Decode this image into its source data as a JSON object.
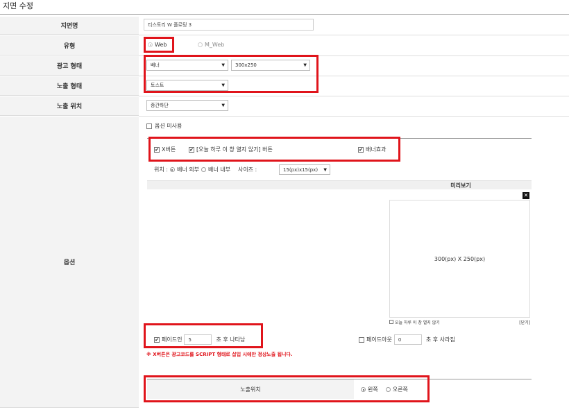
{
  "page": {
    "title": "지면 수정"
  },
  "rows": {
    "name": {
      "label": "지면명",
      "value": "티스토리 W 플로팅 3"
    },
    "type": {
      "label": "유형",
      "options": [
        "Web",
        "M_Web"
      ]
    },
    "ad_format": {
      "label": "광고 형태",
      "format_value": "배너",
      "size_value": "300x250"
    },
    "display_format": {
      "label": "노출 형태",
      "value": "토스트"
    },
    "display_position": {
      "label": "노출 위치",
      "value": "중간하단"
    },
    "options": {
      "label": "옵션"
    }
  },
  "options": {
    "unused_label": "옵션 미사용",
    "x_button_label": "X버튼",
    "no_show_today_label": "[오늘 하루 이 창 열지 않기] 버튼",
    "banner_effect_label": "배너효과",
    "position_label": "위치 :",
    "pos_outside_label": "배너 외부",
    "pos_inside_label": "배너 내부",
    "size_label": "사이즈 :",
    "size_value": "15(px)x15(px)",
    "preview_title": "미리보기",
    "preview_text": "300(px) X 250(px)",
    "preview_footer_left": "오늘 하루 이 창 열지 않기",
    "preview_footer_right": "[닫기]",
    "fade_in_label": "페이드인",
    "fade_in_value": "5",
    "fade_in_suffix": "초 후 나타남",
    "fade_out_label": "페이드아웃",
    "fade_out_value": "0",
    "fade_out_suffix": "초 후 사라짐",
    "warning": "※ X버튼은 광고코드를 SCRIPT 형태로 삽입 시에만 정상노출 됩니다.",
    "expose_position_label": "노출위치",
    "left_label": "왼쪽",
    "right_label": "오른쪽"
  },
  "colors": {
    "highlight": "#e0141b",
    "label_bg": "#f3f3f3"
  }
}
